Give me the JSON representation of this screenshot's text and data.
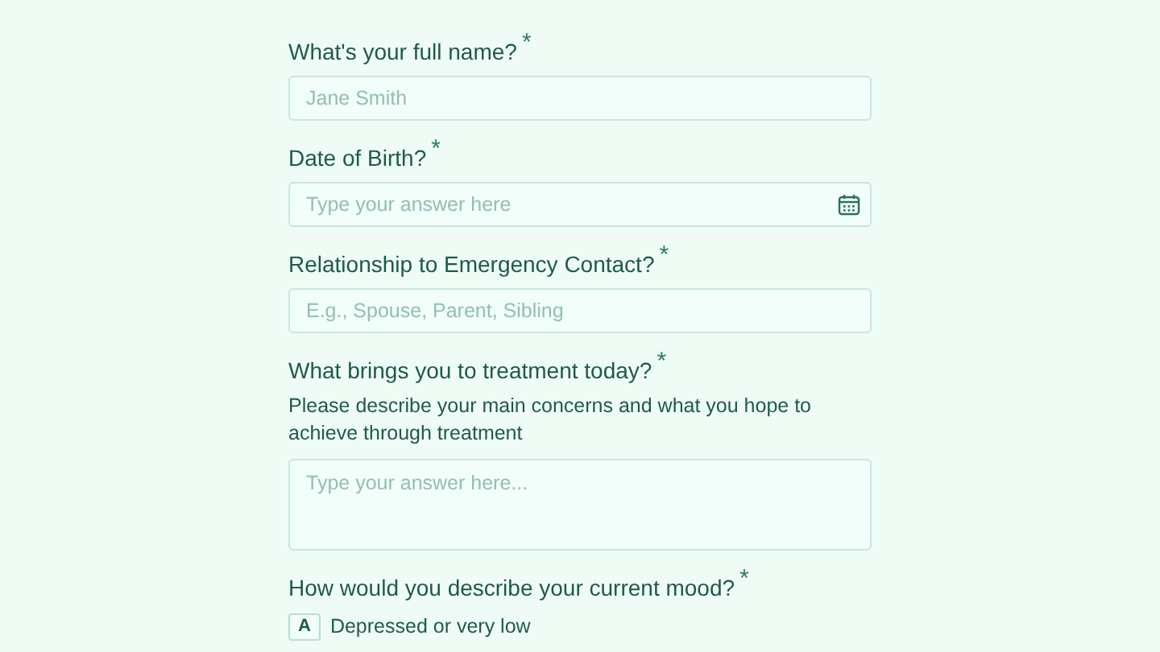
{
  "questions": [
    {
      "kind": "text",
      "label": "What's your full name?",
      "required_mark": "*",
      "placeholder": "Jane Smith"
    },
    {
      "kind": "date",
      "label": "Date of Birth?",
      "required_mark": "*",
      "placeholder": "Type your answer here"
    },
    {
      "kind": "text",
      "label": "Relationship to Emergency Contact?",
      "required_mark": "*",
      "placeholder": "E.g., Spouse, Parent, Sibling"
    },
    {
      "kind": "textarea",
      "label": "What brings you to treatment today?",
      "required_mark": "*",
      "description": "Please describe your main concerns and what you hope to achieve through treatment",
      "placeholder": "Type your answer here..."
    },
    {
      "kind": "choice",
      "label": "How would you describe your current mood?",
      "required_mark": "*",
      "options": [
        {
          "key": "A",
          "label": "Depressed or very low",
          "selected": false
        }
      ]
    }
  ]
}
